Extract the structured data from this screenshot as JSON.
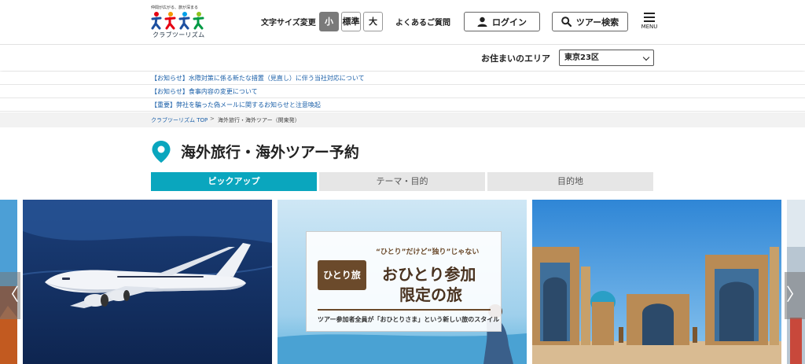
{
  "header": {
    "logo_tagline": "仲間が広がる、旅が深まる",
    "logo_name": "クラブツーリズム",
    "font_size_label": "文字サイズ変更",
    "font_sizes": [
      "小",
      "標準",
      "大"
    ],
    "faq": "よくあるご質問",
    "login": "ログイン",
    "tour_search": "ツアー検索",
    "menu": "MENU"
  },
  "area": {
    "label": "お住まいのエリア",
    "selected": "東京23区"
  },
  "notices": [
    "【お知らせ】水際対策に係る新たな措置（見直し）に伴う当社対応について",
    "【お知らせ】食事内容の変更について",
    "【重要】弊社を騙った偽メールに関するお知らせと注意喚起"
  ],
  "breadcrumb": {
    "home": "クラブツーリズム TOP",
    "separator": ">",
    "current": "海外旅行・海外ツアー（関東発）"
  },
  "page_title": "海外旅行・海外ツアー予約",
  "tabs": [
    "ピックアップ",
    "テーマ・目的",
    "目的地"
  ],
  "carousel": {
    "prev": "〈",
    "next": "〉",
    "card": {
      "badge": "ひとり旅",
      "sub": "“ひとり”だけど“独り”じゃない",
      "main1": "おひとり参加",
      "main2": "限定の旅",
      "foot": "ツアー参加者全員が「おひとりさま」という新しい旅のスタイル"
    }
  },
  "colors": {
    "accent": "#0aa6be",
    "link": "#1a5fa8",
    "brown": "#6b4a2b"
  }
}
